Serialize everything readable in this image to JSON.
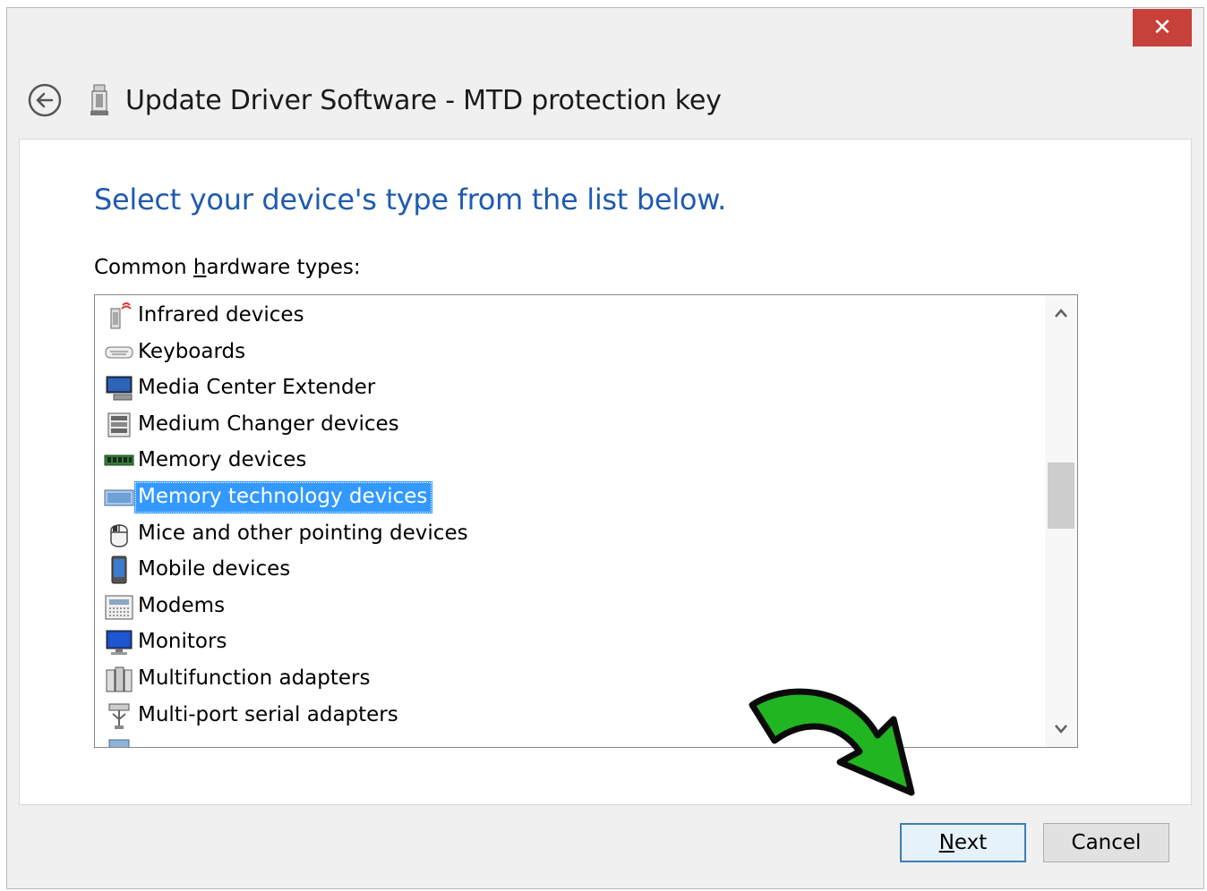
{
  "window": {
    "close_glyph": "✕",
    "close_color": "#c7403a"
  },
  "header": {
    "title": "Update Driver Software - MTD protection key",
    "back_icon": "back-arrow-icon",
    "device_icon": "memory-key-icon"
  },
  "main": {
    "instruction": "Select your device's type from the list below.",
    "instruction_color": "#1f5bb0",
    "list_label_prefix": "Common ",
    "list_label_mnemonic": "h",
    "list_label_suffix": "ardware types:",
    "items": [
      {
        "label": "Infrared devices",
        "icon": "infrared-icon"
      },
      {
        "label": "Keyboards",
        "icon": "keyboard-icon"
      },
      {
        "label": "Media Center Extender",
        "icon": "media-center-icon"
      },
      {
        "label": "Medium Changer devices",
        "icon": "medium-changer-icon"
      },
      {
        "label": "Memory devices",
        "icon": "memory-icon"
      },
      {
        "label": "Memory technology devices",
        "icon": "memory-technology-icon",
        "selected": true
      },
      {
        "label": "Mice and other pointing devices",
        "icon": "mouse-icon"
      },
      {
        "label": "Mobile devices",
        "icon": "mobile-icon"
      },
      {
        "label": "Modems",
        "icon": "modem-icon"
      },
      {
        "label": "Monitors",
        "icon": "monitor-icon"
      },
      {
        "label": "Multifunction adapters",
        "icon": "multifunction-icon"
      },
      {
        "label": "Multi-port serial adapters",
        "icon": "serial-adapter-icon"
      }
    ],
    "selected_color": "#3399ff"
  },
  "footer": {
    "next_mnemonic": "N",
    "next_rest": "ext",
    "cancel_label": "Cancel"
  },
  "annotation": {
    "arrow_color": "#21b521",
    "arrow_icon": "green-curved-arrow-icon"
  }
}
